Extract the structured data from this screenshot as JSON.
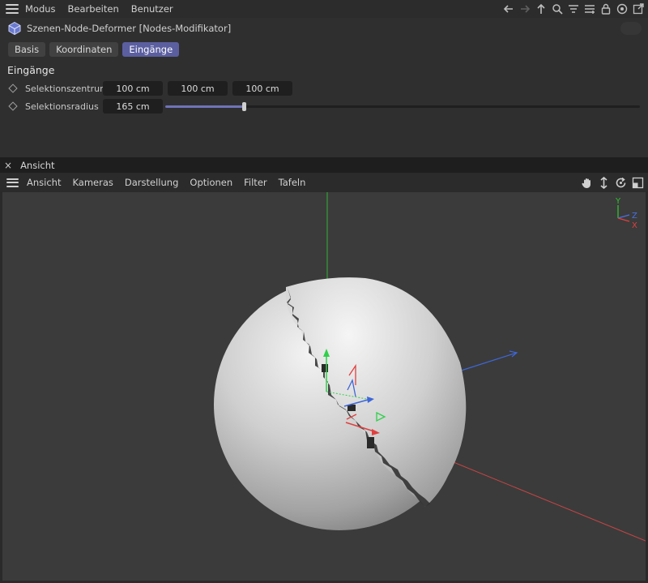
{
  "menubar": {
    "items": [
      "Modus",
      "Bearbeiten",
      "Benutzer"
    ],
    "icons": [
      "arrow-left-icon",
      "arrow-right-icon",
      "arrow-up-icon",
      "search-icon",
      "filter-icon",
      "add-icon",
      "lock-icon",
      "target-icon",
      "new-window-icon"
    ]
  },
  "object": {
    "title": "Szenen-Node-Deformer [Nodes-Modifikator]"
  },
  "tabs": [
    "Basis",
    "Koordinaten",
    "Eingänge"
  ],
  "active_tab": "Eingänge",
  "section": {
    "title": "Eingänge"
  },
  "params": {
    "center": {
      "label": "Selektionszentrum",
      "x": "100 cm",
      "y": "100 cm",
      "z": "100 cm"
    },
    "radius": {
      "label": "Selektionsradius",
      "value": "165 cm",
      "slider_fraction": 0.165
    }
  },
  "viewport_panel": {
    "tab": "Ansicht",
    "close_glyph": "×",
    "menu": [
      "Ansicht",
      "Kameras",
      "Darstellung",
      "Optionen",
      "Filter",
      "Tafeln"
    ],
    "icons": [
      "hand-icon",
      "move-vertical-icon",
      "rotate-icon",
      "maximize-icon"
    ]
  },
  "axis_gizmo": {
    "y": "Y",
    "z": "Z",
    "x": "X"
  },
  "colors": {
    "accent": "#5b5fa0",
    "axis_x": "#e04040",
    "axis_y": "#30c030",
    "axis_z": "#4a6fe0"
  }
}
